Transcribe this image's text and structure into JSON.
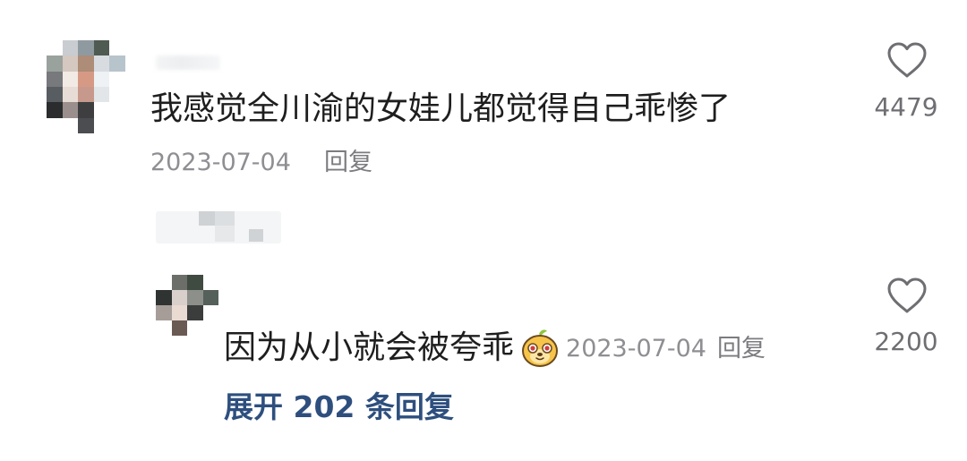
{
  "comment": {
    "text": "我感觉全川渝的女娃儿都觉得自己乖惨了",
    "date": "2023-07-04",
    "reply_label": "回复",
    "like_count": "4479"
  },
  "reply": {
    "text": "因为从小就会被夸乖",
    "emoji": "smiling-dog-emoji",
    "date": "2023-07-04",
    "reply_label": "回复",
    "like_count": "2200",
    "expand_label": "展开 202 条回复"
  },
  "colors": {
    "text_primary": "#1e1e1e",
    "text_secondary": "#8e8e93",
    "link_blue": "#2e4f7e",
    "like_count": "#6e6e73"
  },
  "icons": {
    "like": "heart-outline-icon"
  }
}
